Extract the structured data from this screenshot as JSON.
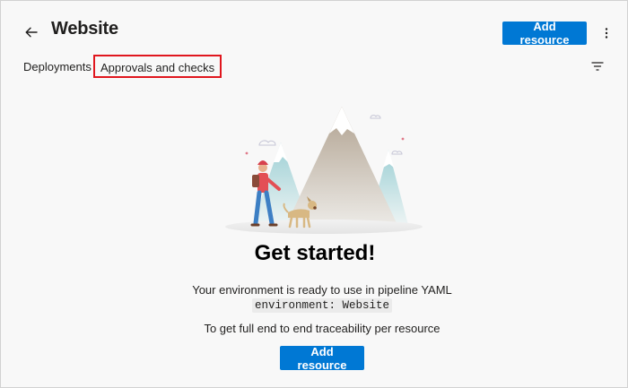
{
  "header": {
    "title": "Website",
    "add_resource_label": "Add resource",
    "back_icon": "arrow-left-icon",
    "more_icon": "more-vertical-icon"
  },
  "tabs": [
    {
      "label": "Deployments",
      "highlighted": false
    },
    {
      "label": "Approvals and checks",
      "highlighted": true
    }
  ],
  "toolbar": {
    "filter_icon": "filter-icon"
  },
  "empty_state": {
    "headline": "Get started!",
    "description": "Your environment is ready to use in pipeline YAML",
    "code": "environment: Website",
    "traceability": "To get full end to end traceability per resource",
    "button_label": "Add resource"
  },
  "colors": {
    "primary": "#0078d4",
    "highlight_box": "#e0161e",
    "background": "#f8f8f8"
  }
}
